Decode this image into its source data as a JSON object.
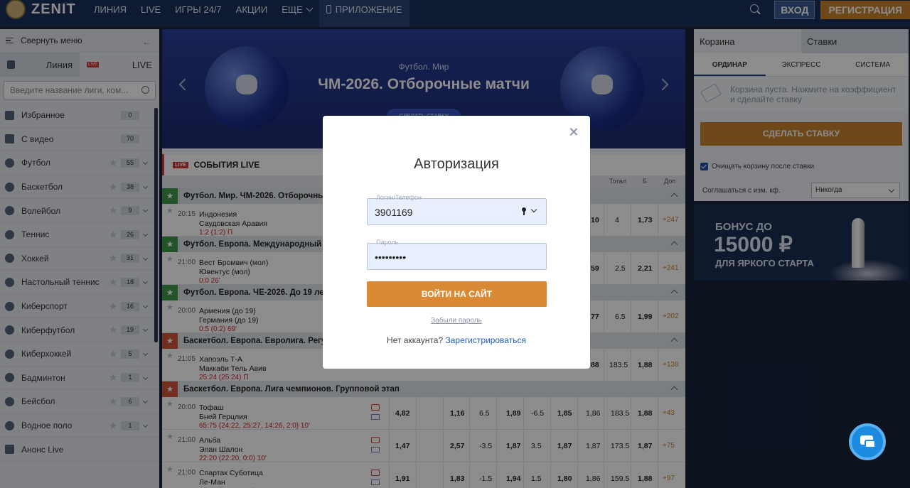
{
  "header": {
    "logo": "ZENIT",
    "nav": [
      "ЛИНИЯ",
      "LIVE",
      "ИГРЫ 24/7",
      "АКЦИИ",
      "ЕЩЕ"
    ],
    "app_label": "ПРИЛОЖЕНИЕ",
    "login_label": "ВХОД",
    "register_label": "РЕГИСТРАЦИЯ"
  },
  "sidebar": {
    "collapse_label": "Свернуть меню",
    "tab_line": "Линия",
    "tab_live": "LIVE",
    "live_badge": "LIVE",
    "search_placeholder": "Введите название лиги, ком...",
    "items": [
      {
        "label": "Избранное",
        "count": "0",
        "star": false,
        "dd": false
      },
      {
        "label": "С видео",
        "count": "70",
        "star": false,
        "dd": false
      },
      {
        "label": "Футбол",
        "count": "55",
        "star": true,
        "dd": true
      },
      {
        "label": "Баскетбол",
        "count": "38",
        "star": true,
        "dd": true
      },
      {
        "label": "Волейбол",
        "count": "9",
        "star": true,
        "dd": true
      },
      {
        "label": "Теннис",
        "count": "26",
        "star": true,
        "dd": true
      },
      {
        "label": "Хоккей",
        "count": "31",
        "star": true,
        "dd": true
      },
      {
        "label": "Настольный теннис",
        "count": "18",
        "star": true,
        "dd": true
      },
      {
        "label": "Киберспорт",
        "count": "16",
        "star": true,
        "dd": true
      },
      {
        "label": "Киберфутбол",
        "count": "19",
        "star": true,
        "dd": true
      },
      {
        "label": "Киберхоккей",
        "count": "5",
        "star": true,
        "dd": true
      },
      {
        "label": "Бадминтон",
        "count": "1",
        "star": true,
        "dd": true
      },
      {
        "label": "Бейсбол",
        "count": "6",
        "star": true,
        "dd": true
      },
      {
        "label": "Водное поло",
        "count": "1",
        "star": true,
        "dd": true
      },
      {
        "label": "Анонс Live",
        "count": "",
        "star": false,
        "dd": false
      }
    ]
  },
  "banner": {
    "subtitle": "Футбол. Мир",
    "title": "ЧМ-2026. Отборочные матчи",
    "button": "СДЕЛАТЬ СТАВКУ"
  },
  "events": {
    "header": "СОБЫТИЯ LIVE",
    "live_badge": "LIVE",
    "columns": [
      "Тотал",
      "Б",
      "Доп"
    ],
    "groups": [
      {
        "title": "Футбол. Мир. ЧМ-2026. Отборочные м",
        "color": "#3f9a48",
        "rows": [
          {
            "time": "20:15",
            "t1": "Индонезия",
            "t2": "Саудовская Аравия",
            "score": "1:2 (1:2) П",
            "odds": [
              "10",
              "4",
              "1,73"
            ],
            "plus": "+247"
          }
        ]
      },
      {
        "title": "Футбол. Европа. Международный куб",
        "color": "#3f9a48",
        "rows": [
          {
            "time": "21:00",
            "t1": "Вест Бромвич (мол)",
            "t2": "Ювентус (мол)",
            "score": "0:0 26'",
            "odds": [
              "59",
              "2.5",
              "2,21"
            ],
            "plus": "+241"
          }
        ]
      },
      {
        "title": "Футбол. Европа. ЧЕ-2026. До 19 лет. С",
        "color": "#3f9a48",
        "rows": [
          {
            "time": "20:00",
            "t1": "Армения (до 19)",
            "t2": "Германия (до 19)",
            "score": "0:5 (0:2) 69'",
            "odds": [
              "77",
              "6.5",
              "1,99"
            ],
            "plus": "+202"
          }
        ]
      },
      {
        "title": "Баскетбол. Европа. Евролига. Регуляр",
        "color": "#d0543a",
        "rows": [
          {
            "time": "21:05",
            "t1": "Хапоэль Т-А",
            "t2": "Маккаби Тель Авив",
            "score": "25:24 (25:24) П",
            "odds": [
              "88",
              "183.5",
              "1,88"
            ],
            "plus": "+138"
          }
        ]
      },
      {
        "title": "Баскетбол. Европа. Лига чемпионов. Групповой этап",
        "color": "#d0543a",
        "rows": [
          {
            "time": "20:00",
            "t1": "Тофаш",
            "t2": "Бней Герцлия",
            "score": "65:75 (24:22, 25:27, 14:26, 2:0) 10'",
            "full": [
              "4,82",
              "",
              "1,16",
              "6.5",
              "1,89",
              "-6.5",
              "1,85",
              "1,86",
              "183.5",
              "1,88"
            ],
            "plus": "+43"
          },
          {
            "time": "21:00",
            "t1": "Альба",
            "t2": "Элан Шалон",
            "score": "22:20 (22:20, 0:0) 10'",
            "full": [
              "1,47",
              "",
              "2,57",
              "-3.5",
              "1,87",
              "3.5",
              "1,87",
              "1,87",
              "173.5",
              "1,87"
            ],
            "plus": "+75"
          },
          {
            "time": "21:00",
            "t1": "Спартак Суботица",
            "t2": "Ле-Ман",
            "score": "20:22 (18:12, 2:4) 8'",
            "full": [
              "1,91",
              "",
              "1,83",
              "-1.5",
              "1,94",
              "1.5",
              "1,80",
              "1,86",
              "159.5",
              "1,88"
            ],
            "plus": "+97"
          }
        ]
      }
    ]
  },
  "cart": {
    "tab_cart": "Корзина",
    "tab_bets": "Ставки",
    "sub": [
      "ОРДИНАР",
      "ЭКСПРЕСС",
      "СИСТЕМА"
    ],
    "empty": "Корзина пуста. Нажмите на коэффициент и сделайте ставку",
    "button": "СДЕЛАТЬ СТАВКУ",
    "clear_label": "Очищать корзину после ставки",
    "agree_label": "Соглашаться с изм. кф.",
    "agree_value": "Никогда"
  },
  "promo": {
    "line1": "БОНУС ДО",
    "line2": "15000 ₽",
    "line3": "ДЛЯ ЯРКОГО СТАРТА"
  },
  "modal": {
    "title": "Авторизация",
    "login_label": "Логин/Телефон",
    "login_value": "3901169",
    "password_label": "Пароль",
    "password_value": "•••••••••",
    "submit": "ВОЙТИ НА САЙТ",
    "forgot": "Забыли пароль",
    "no_account": "Нет аккаунта?",
    "register": "Зарегистрироваться"
  }
}
